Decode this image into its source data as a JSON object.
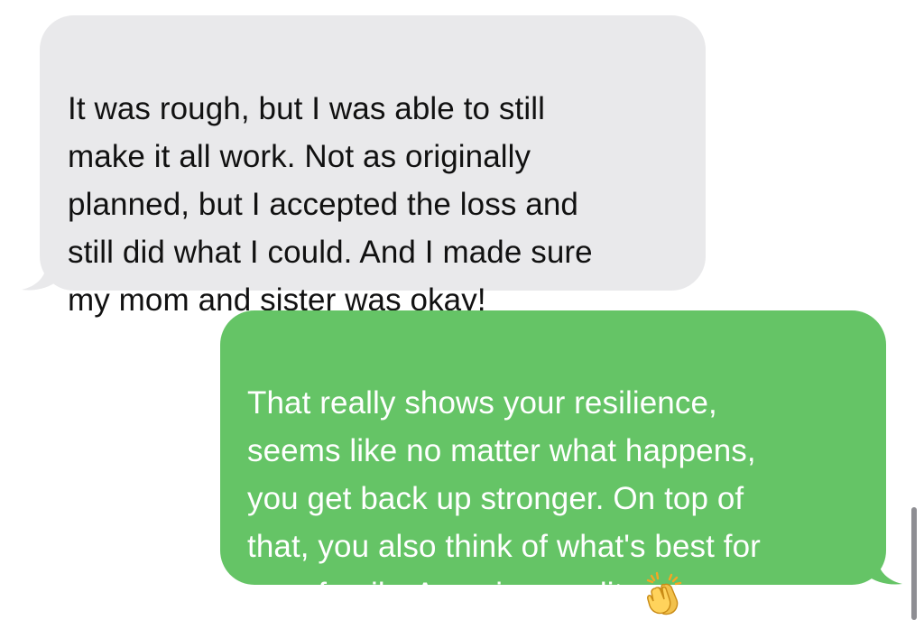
{
  "messages": [
    {
      "direction": "received",
      "text": "It was rough, but I was able to still\nmake it all work. Not as originally\nplanned, but I accepted the loss and\nstill did what I could. And I made sure\nmy mom and sister was okay!"
    },
    {
      "direction": "sent",
      "text": "That really shows your resilience,\nseems like no matter what happens,\nyou get back up stronger. On top of\nthat, you also think of what's best for\nyour family. Amazing quality",
      "emoji": "clapping-hands-icon"
    }
  ],
  "colors": {
    "received_bubble": "#e9e9eb",
    "received_text": "#111111",
    "sent_bubble": "#65c466",
    "sent_text": "#ffffff",
    "scrollbar": "#8e8e93",
    "background": "#ffffff"
  }
}
